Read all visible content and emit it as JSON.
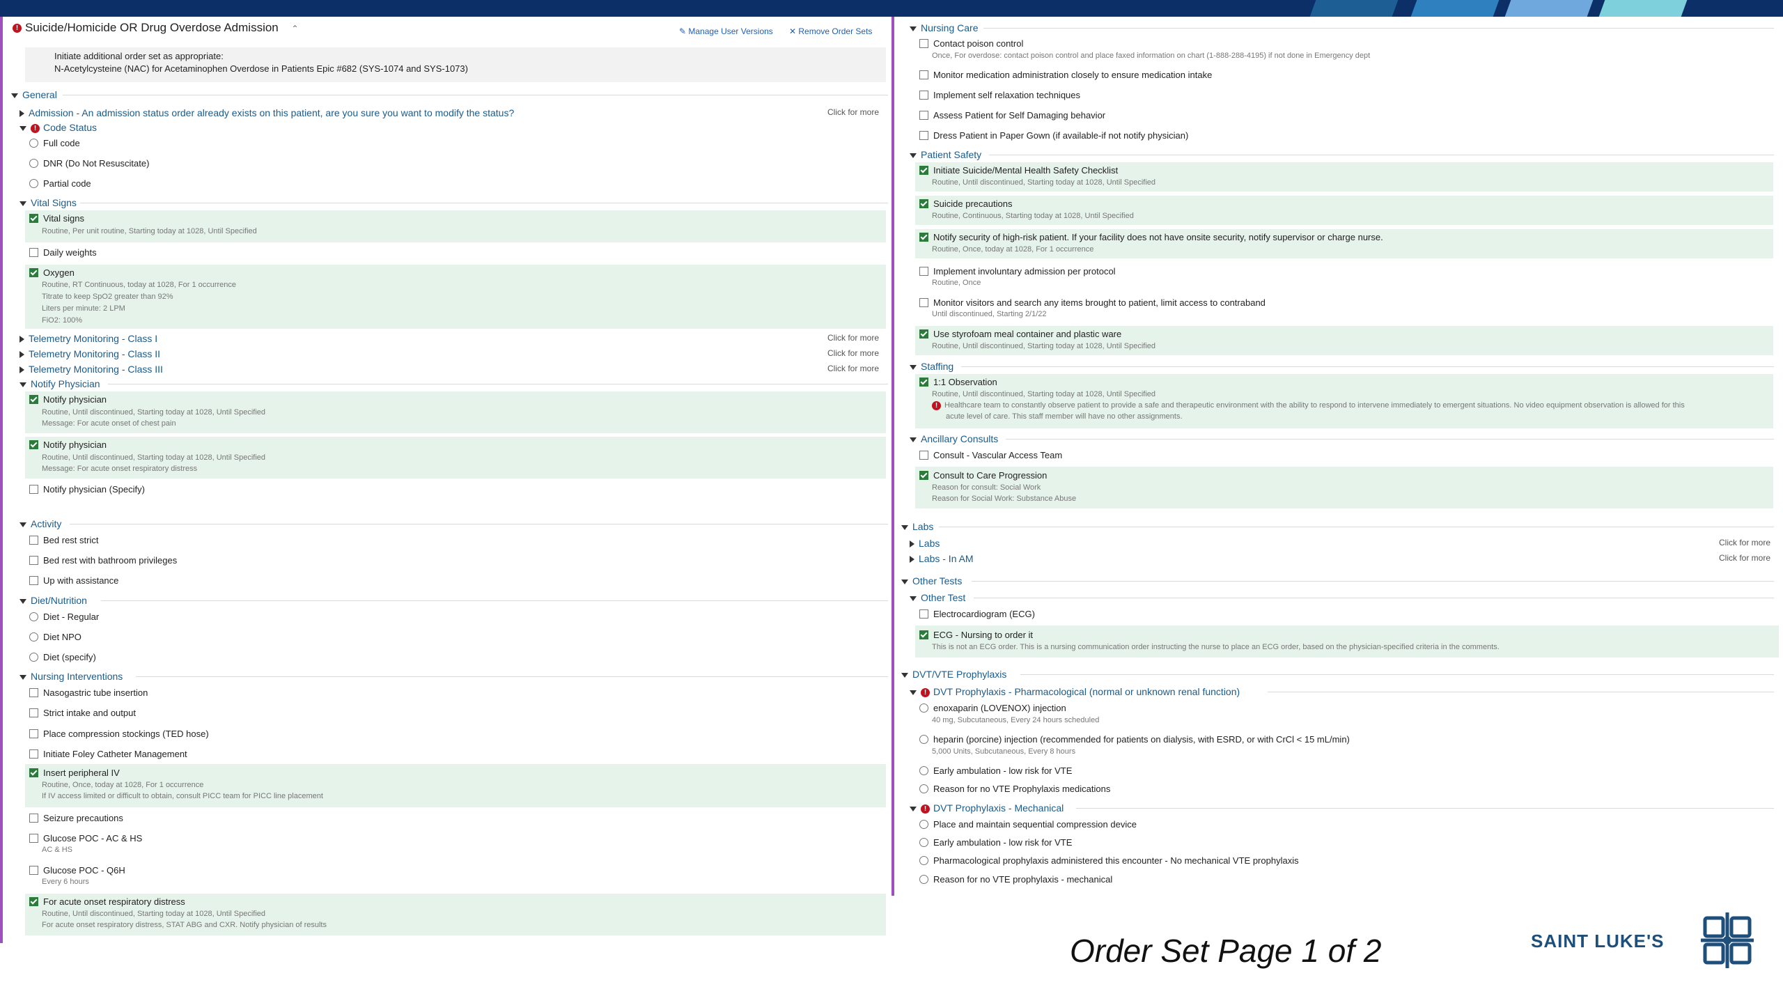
{
  "header": {
    "title": "Suicide/Homicide OR Drug Overdose Admission",
    "manage_user_versions": "Manage User Versions",
    "remove_order_sets": "Remove Order Sets",
    "note_line1": "Initiate additional order set as appropriate:",
    "note_line2": "N-Acetylcysteine (NAC) for Acetaminophen Overdose in Patients Epic #682 (SYS-1074 and SYS-1073)"
  },
  "click_for_more": "Click for more",
  "left": {
    "general": "General",
    "admission": "Admission - An admission status order already exists on this patient, are you sure you want to modify the status?",
    "code_status": "Code Status",
    "full_code": "Full code",
    "dnr": "DNR (Do Not Resuscitate)",
    "partial_code": "Partial code",
    "vital_signs_hdr": "Vital Signs",
    "vital_signs": "Vital signs",
    "vital_signs_d1": "Routine, Per unit routine, Starting today at 1028, Until Specified",
    "daily_weights": "Daily weights",
    "oxygen": "Oxygen",
    "oxygen_d1": "Routine, RT Continuous, today at 1028, For 1 occurrence",
    "oxygen_d2": "Titrate to keep SpO2 greater than 92%",
    "oxygen_d3": "Liters per minute: 2 LPM",
    "oxygen_d4": "FiO2: 100%",
    "tele1": "Telemetry Monitoring - Class I",
    "tele2": "Telemetry Monitoring - Class II",
    "tele3": "Telemetry Monitoring - Class III",
    "notify_hdr": "Notify Physician",
    "notify1": "Notify physician",
    "notify1_d1": "Routine, Until discontinued, Starting today at 1028, Until Specified",
    "notify1_d2": "Message: For acute onset of chest pain",
    "notify2": "Notify physician",
    "notify2_d1": "Routine, Until discontinued, Starting today at 1028, Until Specified",
    "notify2_d2": "Message: For acute onset respiratory distress",
    "notify3": "Notify physician (Specify)",
    "activity_hdr": "Activity",
    "bed_rest_strict": "Bed rest strict",
    "bed_rest_bath": "Bed rest with bathroom privileges",
    "up_with_assist": "Up with assistance",
    "diet_hdr": "Diet/Nutrition",
    "diet_regular": "Diet - Regular",
    "diet_npo": "Diet NPO",
    "diet_specify": "Diet (specify)",
    "nursing_int_hdr": "Nursing Interventions",
    "ng_tube": "Nasogastric tube insertion",
    "strict_io": "Strict intake and output",
    "ted_hose": "Place compression stockings (TED hose)",
    "foley": "Initiate Foley Catheter Management",
    "insert_iv": "Insert peripheral IV",
    "insert_iv_d1": "Routine, Once, today at 1028, For 1 occurrence",
    "insert_iv_d2": "If IV access limited or difficult to obtain, consult PICC team for PICC line placement",
    "seizure": "Seizure precautions",
    "glucose_ac": "Glucose POC - AC & HS",
    "glucose_ac_d1": "AC & HS",
    "glucose_q6": "Glucose POC - Q6H",
    "glucose_q6_d1": "Every 6 hours",
    "resp_distress": "For acute onset respiratory distress",
    "resp_distress_d1": "Routine, Until discontinued, Starting today at 1028, Until Specified",
    "resp_distress_d2": "For acute onset respiratory distress, STAT ABG and CXR. Notify physician of results"
  },
  "right": {
    "nursing_care_hdr": "Nursing Care",
    "poison_control": "Contact poison control",
    "poison_control_d1": "Once, For overdose: contact poison control and place faxed information on chart (1-888-288-4195) if not done in Emergency dept",
    "monitor_med": "Monitor medication administration closely to ensure medication intake",
    "self_relax": "Implement self relaxation techniques",
    "assess_self": "Assess Patient for Self Damaging behavior",
    "paper_gown": "Dress Patient in Paper Gown (if available-if not notify physician)",
    "patient_safety_hdr": "Patient Safety",
    "checklist": "Initiate Suicide/Mental Health Safety Checklist",
    "checklist_d1": "Routine, Until discontinued, Starting today at 1028, Until Specified",
    "suicide_prec": "Suicide precautions",
    "suicide_prec_d1": "Routine, Continuous, Starting today at 1028, Until Specified",
    "notify_security": "Notify security of high-risk patient. If your facility does not have onsite security, notify supervisor or charge nurse.",
    "notify_security_d1": "Routine, Once, today at 1028, For 1 occurrence",
    "involuntary": "Implement involuntary admission per protocol",
    "involuntary_d1": "Routine, Once",
    "monitor_visitors": "Monitor visitors and search any items brought to patient, limit access to contraband",
    "monitor_visitors_d1": "Until discontinued, Starting 2/1/22",
    "styrofoam": "Use styrofoam meal container and plastic ware",
    "styrofoam_d1": "Routine, Until discontinued, Starting today at 1028, Until Specified",
    "staffing_hdr": "Staffing",
    "observation": "1:1 Observation",
    "observation_d1": "Routine, Until discontinued, Starting today at 1028, Until Specified",
    "observation_d2": "Healthcare team to constantly observe patient to provide a safe and therapeutic environment with the ability to respond to intervene immediately to emergent situations. No video equipment observation is allowed for this",
    "observation_d3": "acute level of care. This staff member will have no other assignments.",
    "ancillary_hdr": "Ancillary Consults",
    "vascular": "Consult - Vascular Access Team",
    "care_prog": "Consult to Care Progression",
    "care_prog_d1": "Reason for consult: Social Work",
    "care_prog_d2": "Reason for Social Work: Substance Abuse",
    "labs_hdr": "Labs",
    "labs": "Labs",
    "labs_am": "Labs - In AM",
    "other_tests_hdr": "Other Tests",
    "other_test_sub": "Other Test",
    "ecg": "Electrocardiogram (ECG)",
    "ecg_nursing": "ECG - Nursing to order it",
    "ecg_nursing_d1": "This is not an ECG order. This is a nursing communication order instructing the nurse to place an ECG order, based on the physician-specified criteria in the comments.",
    "dvt_hdr": "DVT/VTE Prophylaxis",
    "dvt_pharm": "DVT Prophylaxis - Pharmacological (normal or unknown renal function)",
    "enoxaparin": "enoxaparin (LOVENOX) injection",
    "enoxaparin_d1": "40 mg, Subcutaneous, Every 24 hours scheduled",
    "heparin": "heparin (porcine) injection (recommended for patients on dialysis, with ESRD, or with CrCl < 15 mL/min)",
    "heparin_d1": "5,000 Units, Subcutaneous, Every 8 hours",
    "early_amb1": "Early ambulation - low risk for VTE",
    "reason_no_vte": "Reason for no VTE Prophylaxis medications",
    "dvt_mech": "DVT Prophylaxis - Mechanical",
    "scd": "Place and maintain sequential compression device",
    "early_amb2": "Early ambulation - low risk for VTE",
    "pharm_admin": "Pharmacological prophylaxis administered this encounter - No mechanical VTE prophylaxis",
    "reason_no_mech": "Reason for no VTE prophylaxis - mechanical"
  },
  "footer": {
    "page_label": "Order Set Page 1 of 2",
    "brand": "SAINT LUKE'S"
  },
  "colors": {
    "accent_purple": "#a04fc0",
    "selected_bg": "#e6f3ea",
    "header_blue": "#1a5b8c",
    "brand_navy": "#0b2f66",
    "error_red": "#c1121f"
  }
}
